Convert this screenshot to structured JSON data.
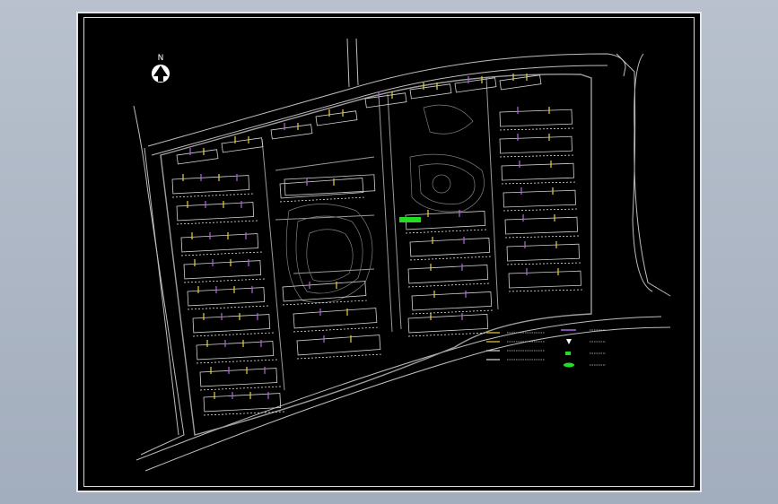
{
  "drawing": {
    "north_label": "N"
  },
  "legend": {
    "items": [
      {
        "symbol": "yellow-line",
        "text": ""
      },
      {
        "symbol": "yellow-line",
        "text": ""
      },
      {
        "symbol": "white-line",
        "text": ""
      },
      {
        "symbol": "white-line",
        "text": ""
      },
      {
        "symbol": "purple-line",
        "text": ""
      },
      {
        "symbol": "white-marker",
        "text": ""
      },
      {
        "symbol": "green-dot",
        "text": ""
      },
      {
        "symbol": "green-oval",
        "text": ""
      }
    ]
  },
  "colors": {
    "background": "#000000",
    "frame": "#e6e6e6",
    "lines": "#c8c8c8",
    "building": "#d0d0d0",
    "accent_yellow": "#e8d23a",
    "accent_purple": "#b066e0",
    "accent_green": "#22dd22"
  }
}
